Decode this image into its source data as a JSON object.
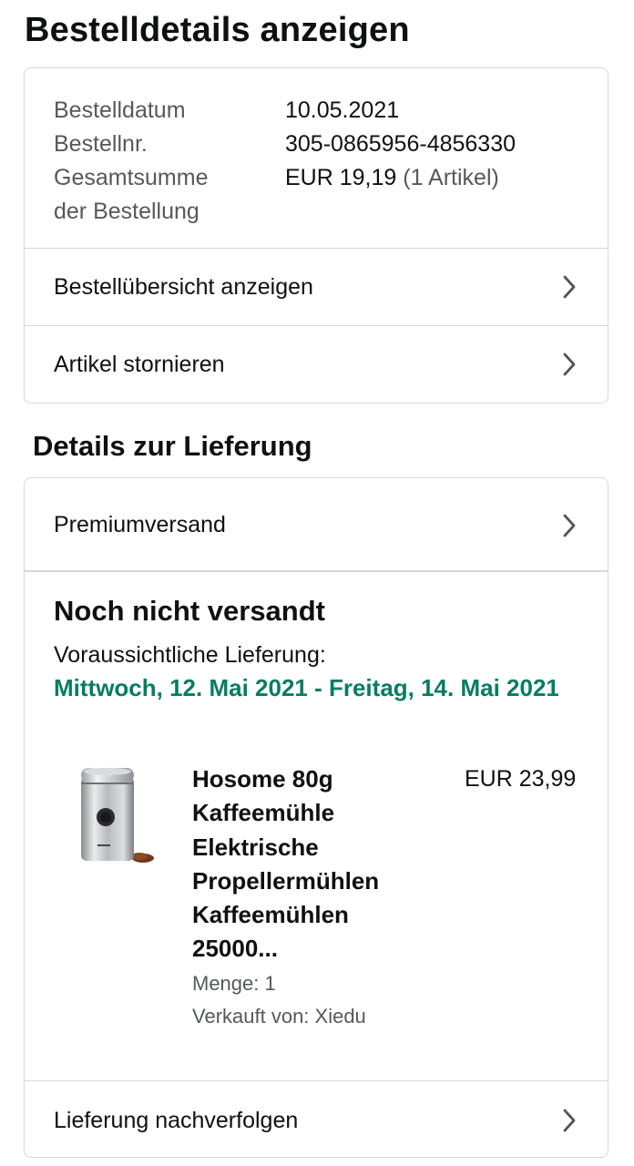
{
  "page": {
    "title": "Bestelldetails anzeigen"
  },
  "summary": {
    "rows": [
      {
        "label": "Bestelldatum",
        "value": "10.05.2021"
      },
      {
        "label": "Bestellnr.",
        "value": "305-0865956-4856330"
      },
      {
        "label": "Gesamtsumme",
        "label2": "der Bestellung",
        "value": "EUR 19,19",
        "value_note": "(1 Artikel)"
      }
    ],
    "links": {
      "overview": "Bestellübersicht anzeigen",
      "cancel": "Artikel stornieren"
    }
  },
  "delivery": {
    "section_title": "Details zur Lieferung",
    "shipping_method": "Premiumversand",
    "status": "Noch nicht versandt",
    "eta_label": "Voraussichtliche Lieferung:",
    "eta_date": "Mittwoch, 12. Mai 2021 - Freitag, 14. Mai 2021",
    "item": {
      "name": "Hosome 80g Kaffeemühle Elektrische Propellermühlen Kaffeemühlen 25000...",
      "price": "EUR 23,99",
      "quantity": "Menge: 1",
      "seller": "Verkauft von: Xiedu"
    },
    "track_link": "Lieferung nachverfolgen"
  },
  "colors": {
    "accent_green": "#067d62",
    "muted_text": "#565959",
    "border": "#d5d9d9"
  },
  "icons": {
    "row_chevron": "chevron-right-icon"
  }
}
